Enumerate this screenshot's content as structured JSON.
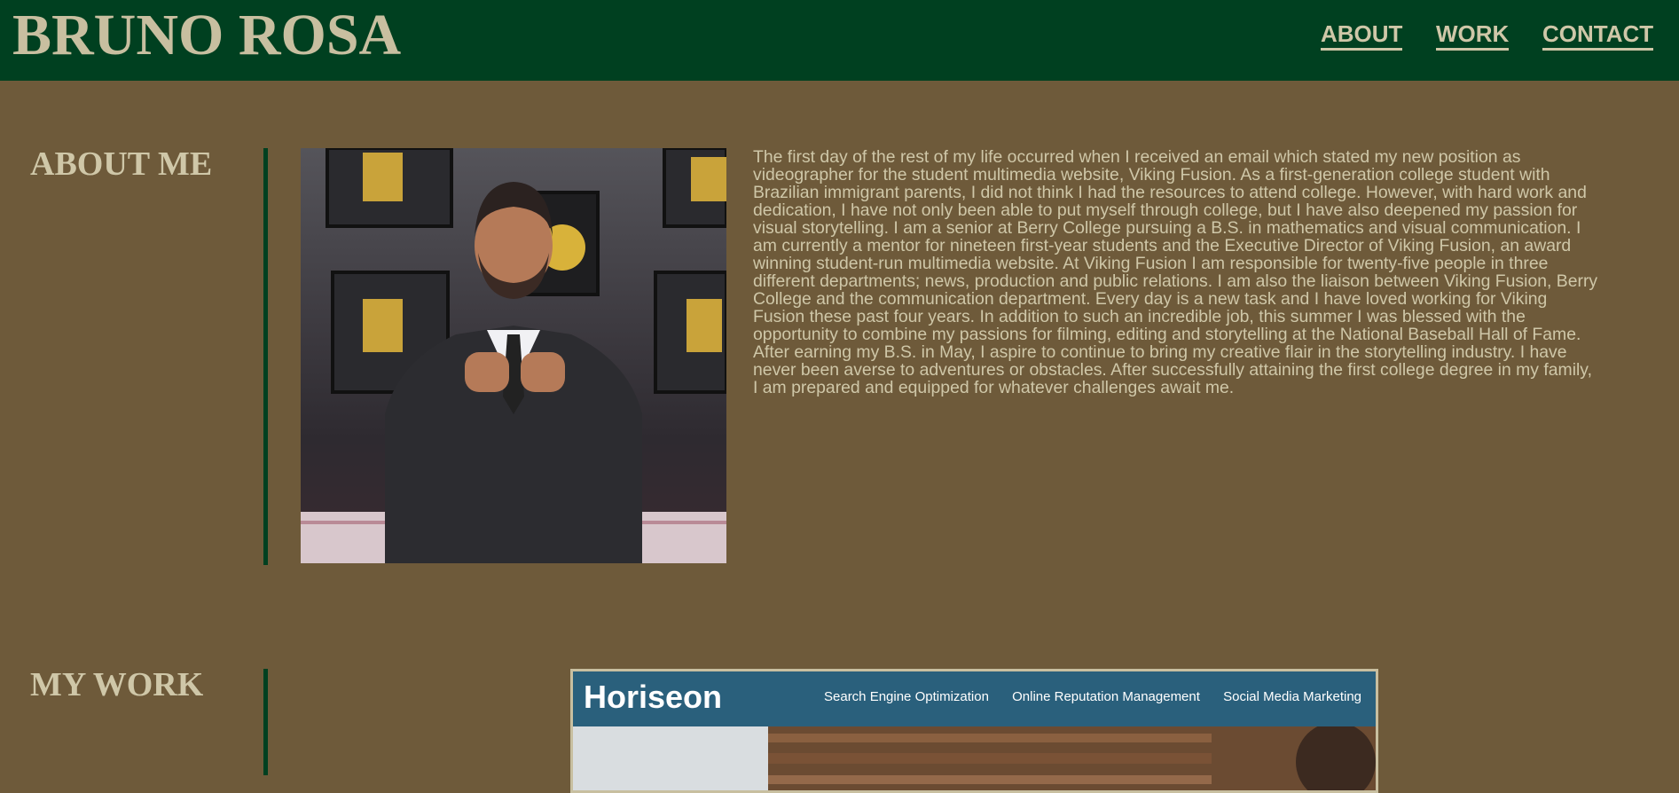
{
  "header": {
    "site_title": "BRUNO ROSA",
    "nav": {
      "about": "ABOUT",
      "work": "WORK",
      "contact": "CONTACT"
    }
  },
  "about": {
    "heading": "ABOUT ME",
    "photo_icon": "portrait-photo",
    "body": "The first day of the rest of my life occurred when I received an email which stated my new position as videographer for the student multimedia website, Viking Fusion. As a first-generation college student with Brazilian immigrant parents, I did not think I had the resources to attend college. However, with hard work and dedication, I have not only been able to put myself through college, but I have also deepened my passion for visual storytelling. I am a senior at Berry College pursuing a B.S. in mathematics and visual communication. I am currently a mentor for nineteen first-year students and the Executive Director of Viking Fusion, an award winning student-run multimedia website. At Viking Fusion I am responsible for twenty-five people in three different departments; news, production and public relations. I am also the liaison between Viking Fusion, Berry College and the communication department. Every day is a new task and I have loved working for Viking Fusion these past four years. In addition to such an incredible job, this summer I was blessed with the opportunity to combine my passions for filming, editing and storytelling at the National Baseball Hall of Fame. After earning my B.S. in May, I aspire to continue to bring my creative flair in the storytelling industry. I have never been averse to adventures or obstacles. After successfully attaining the first college degree in my family, I am prepared and equipped for whatever challenges await me."
  },
  "work": {
    "heading": "MY WORK",
    "project": {
      "brand": "Horiseon",
      "links": [
        "Search Engine Optimization",
        "Online Reputation Management",
        "Social Media Marketing"
      ]
    }
  },
  "colors": {
    "page_bg": "#6e5a3a",
    "header_bg": "#004020",
    "text": "#cfc7a8"
  }
}
